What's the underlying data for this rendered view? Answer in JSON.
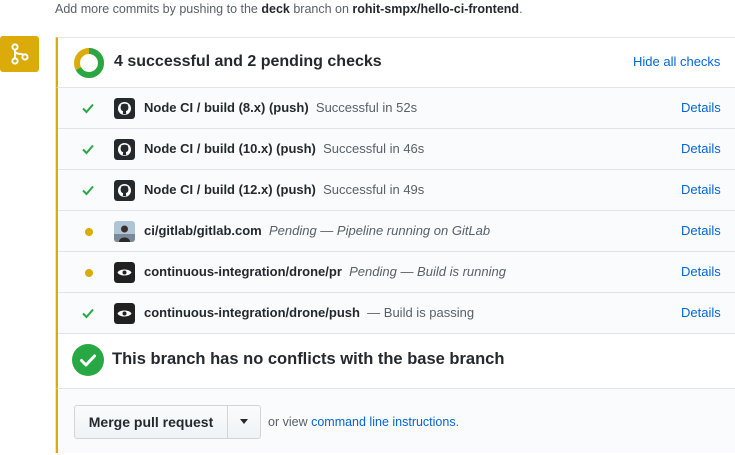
{
  "note": {
    "prefix": "Add more commits by pushing to the ",
    "branch": "deck",
    "middle": " branch on ",
    "repo": "rohit-smpx/hello-ci-frontend",
    "suffix": "."
  },
  "status": {
    "title": "4 successful and 2 pending checks",
    "hide_label": "Hide all checks",
    "successful": 4,
    "pending": 2
  },
  "checks": [
    {
      "name": "Node CI / build (8.x) (push)",
      "desc": "Successful in 52s",
      "state": "success",
      "avatar": "github-icon",
      "details": "Details"
    },
    {
      "name": "Node CI / build (10.x) (push)",
      "desc": "Successful in 46s",
      "state": "success",
      "avatar": "github-icon",
      "details": "Details"
    },
    {
      "name": "Node CI / build (12.x) (push)",
      "desc": "Successful in 49s",
      "state": "success",
      "avatar": "github-icon",
      "details": "Details"
    },
    {
      "name": "ci/gitlab/gitlab.com",
      "desc": "Pending — Pipeline running on GitLab",
      "state": "pending",
      "avatar": "user-avatar",
      "details": "Details"
    },
    {
      "name": "continuous-integration/drone/pr",
      "desc": "Pending — Build is running",
      "state": "pending",
      "avatar": "drone-icon",
      "details": "Details"
    },
    {
      "name": "continuous-integration/drone/push",
      "desc": "— Build is passing",
      "state": "success",
      "avatar": "drone-icon",
      "details": "Details"
    }
  ],
  "conflicts": {
    "title": "This branch has no conflicts with the base branch"
  },
  "merge": {
    "button_label": "Merge pull request",
    "or_view": "or view ",
    "cli_link": "command line instructions",
    "suffix": "."
  },
  "colors": {
    "pending": "#dbab09",
    "success": "#28a745",
    "link": "#0366d6"
  }
}
